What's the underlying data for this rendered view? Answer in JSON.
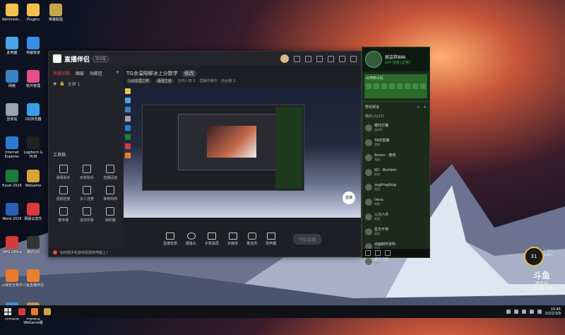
{
  "desktop": {
    "col1": [
      "Administr...",
      "此电脑",
      "网络",
      "回收站",
      "Internet Explorer",
      "Excel 2016",
      "Word 2016",
      "WPS Office",
      "火绒安全软件",
      "控制面板"
    ],
    "col2": [
      "Plugins",
      "电脑管家",
      "软件管理",
      "QQ浏览器",
      "Logitech G HUB",
      "WeGame",
      "网易云音乐",
      "腾讯QQ",
      "斗鱼直播伴侣",
      "英雄联盟 WeGame版"
    ],
    "col3": [
      "英雄联盟"
    ]
  },
  "main_window": {
    "app_name": "直播伴侣",
    "badge": "测试版",
    "tabs": [
      "场景切换",
      "图层",
      "功能区"
    ],
    "scene": "全屏 1",
    "tools_title": "工具箱",
    "tools": [
      "弹幕助手",
      "房管助手",
      "直播回放",
      "视频连麦",
      "多人连麦",
      "推荐特权",
      "麦序播",
      "虚拟形象",
      "抽奖器"
    ],
    "live_title": "TG余温陪聊冰上分数学",
    "edit": "修改",
    "sub": [
      "Lol/这里之亭",
      "最强王者",
      "在线人数 2",
      "直播开播中",
      "粉丝数 2"
    ],
    "bottom_tools": [
      "直播背景",
      "摄像头",
      "手机投屏",
      "多媒体",
      "麦克风",
      "扬声器"
    ],
    "start_button": "开始直播",
    "status": "如何把手机游戏投屏到电脑上？",
    "preview_badge": "直播"
  },
  "yy_panel": {
    "name": "就这样886",
    "status": "LV4 在线 [正常]",
    "team_title": "公开的小队",
    "section": "群组频道",
    "group": "我的 (1/17)",
    "friends": [
      {
        "name": "哪吒打雕",
        "sub": "游戏中"
      },
      {
        "name": "TA的直播",
        "sub": "离线"
      },
      {
        "name": "Anson · 离线",
        "sub": "离线"
      },
      {
        "name": "KO · Richlein",
        "sub": "离线"
      },
      {
        "name": "zegifroglbug",
        "sub": "离线"
      },
      {
        "name": "Irena",
        "sub": "离线"
      },
      {
        "name": "三元六月",
        "sub": "离线"
      },
      {
        "name": "星光不停",
        "sub": "离线"
      },
      {
        "name": "动画制作资料",
        "sub": "离线"
      },
      {
        "name": "逆光飞翔",
        "sub": "离线"
      }
    ]
  },
  "widget": {
    "cpu": "31",
    "net_up": "0.2K/s",
    "net_down": "0.6K/s"
  },
  "watermark": {
    "logo": "斗鱼",
    "site": "虎牙号",
    "number": "10868700"
  },
  "taskbar": {
    "time": "15:45",
    "date": "2022/3/9"
  }
}
